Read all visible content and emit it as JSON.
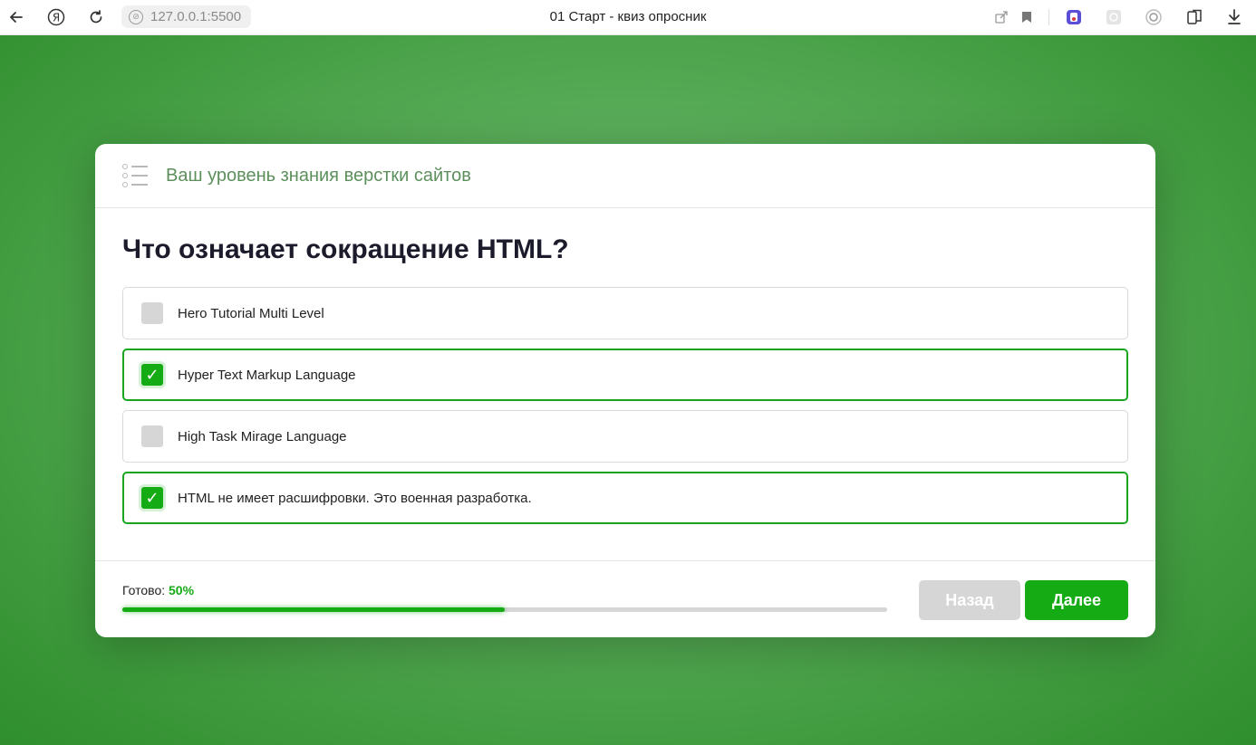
{
  "browser": {
    "url": "127.0.0.1:5500",
    "tab_title": "01 Старт - квиз опросник",
    "icons": [
      "back-arrow-icon",
      "yandex-icon",
      "reload-icon",
      "globe-icon",
      "share-icon",
      "bookmark-icon",
      "extension-icon",
      "extension-icon",
      "extension-icon",
      "collections-icon",
      "download-icon"
    ]
  },
  "quiz": {
    "header_title": "Ваш уровень знания верстки сайтов",
    "question": "Что означает сокращение HTML?",
    "answers": [
      {
        "label": "Hero Tutorial Multi Level",
        "checked": false
      },
      {
        "label": "Hyper Text Markup Language",
        "checked": true
      },
      {
        "label": "High Task Mirage Language",
        "checked": false
      },
      {
        "label": "HTML не имеет расшифровки. Это военная разработка.",
        "checked": true
      }
    ],
    "progress": {
      "label": "Готово:",
      "value_text": "50%",
      "fraction": 0.5
    },
    "buttons": {
      "back": "Назад",
      "next": "Далее"
    }
  },
  "colors": {
    "accent": "#14ab14",
    "background_green": "#5aad5a",
    "header_title": "#5c8f5c",
    "disabled": "#d6d6d6"
  }
}
